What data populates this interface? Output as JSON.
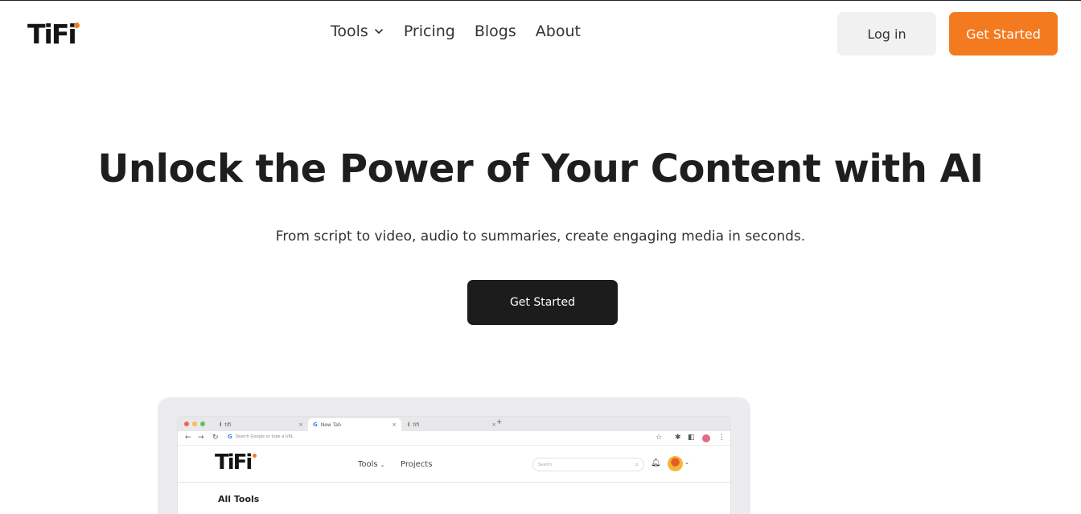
{
  "header": {
    "logo_text": "TiFi",
    "nav": [
      {
        "label": "Tools",
        "has_dropdown": true
      },
      {
        "label": "Pricing"
      },
      {
        "label": "Blogs"
      },
      {
        "label": "About"
      }
    ],
    "login_label": "Log in",
    "get_started_label": "Get Started"
  },
  "hero": {
    "title": "Unlock the Power of Your Content with AI",
    "subtitle": "From script to video, audio to summaries, create engaging media in seconds.",
    "cta_label": "Get Started"
  },
  "preview": {
    "tabs": [
      {
        "label": "tifi",
        "active": false
      },
      {
        "label": "New Tab",
        "active": true
      },
      {
        "label": "tifi",
        "active": false
      }
    ],
    "address_placeholder": "Search Google or type a URL",
    "app": {
      "logo_text": "TiFi",
      "nav": [
        {
          "label": "Tools",
          "has_dropdown": true
        },
        {
          "label": "Projects"
        }
      ],
      "search_placeholder": "Search",
      "section_title": "All Tools"
    }
  },
  "colors": {
    "accent": "#f47a1f",
    "dark_button": "#1c1c1c",
    "light_button": "#f1f1f1",
    "text": "#1e1e1e"
  },
  "icons": [
    "chevron-down-icon",
    "back-arrow-icon",
    "forward-arrow-icon",
    "reload-icon",
    "star-icon",
    "extensions-icon",
    "bell-icon",
    "search-icon"
  ]
}
